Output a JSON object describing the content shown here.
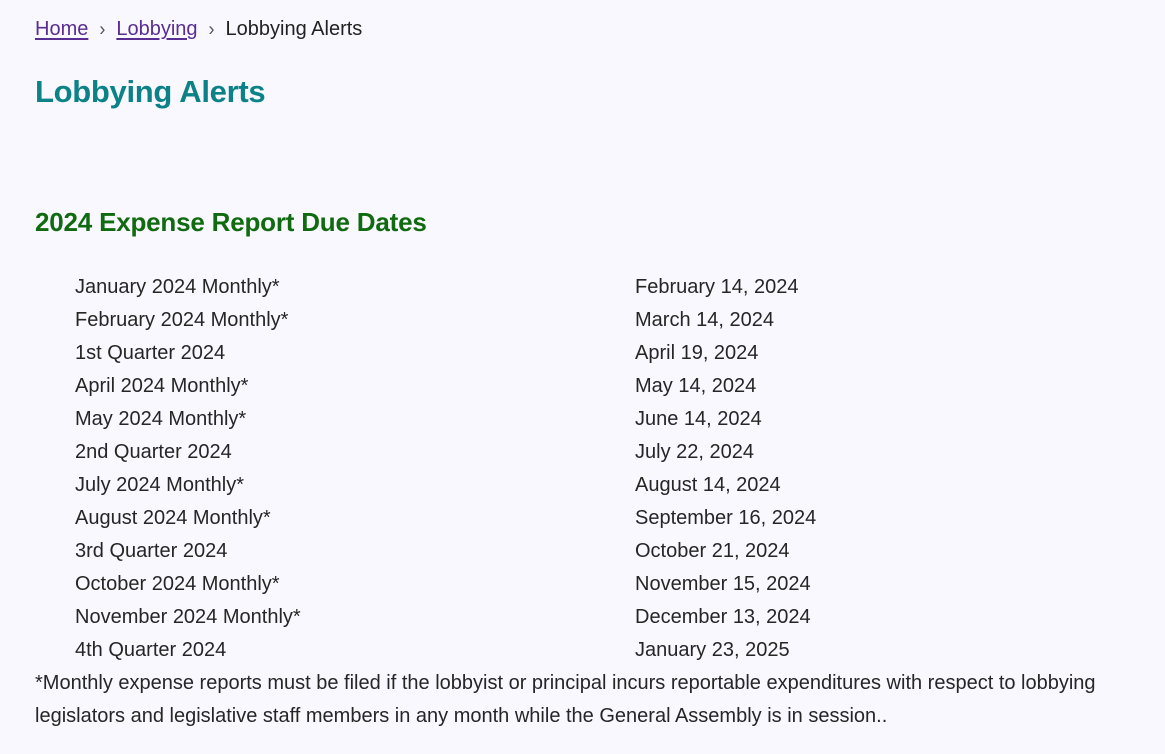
{
  "breadcrumb": {
    "items": [
      {
        "label": "Home",
        "link": true
      },
      {
        "label": "Lobbying",
        "link": true
      },
      {
        "label": "Lobbying Alerts",
        "link": false
      }
    ],
    "separator": "›"
  },
  "page_title": "Lobbying Alerts",
  "section": {
    "title": "2024 Expense Report Due Dates",
    "rows": [
      {
        "period": "January 2024 Monthly*",
        "due": "February 14, 2024"
      },
      {
        "period": "February 2024 Monthly*",
        "due": "March 14, 2024"
      },
      {
        "period": "1st Quarter 2024",
        "due": "April 19, 2024"
      },
      {
        "period": "April 2024 Monthly*",
        "due": "May 14, 2024"
      },
      {
        "period": "May 2024 Monthly*",
        "due": "June 14, 2024"
      },
      {
        "period": "2nd Quarter 2024",
        "due": "July 22, 2024"
      },
      {
        "period": "July 2024 Monthly*",
        "due": "August 14, 2024"
      },
      {
        "period": "August 2024 Monthly*",
        "due": "September 16, 2024"
      },
      {
        "period": "3rd Quarter 2024",
        "due": "October 21, 2024"
      },
      {
        "period": "October 2024 Monthly*",
        "due": "November 15, 2024"
      },
      {
        "period": "November 2024 Monthly*",
        "due": "December 13, 2024"
      },
      {
        "period": "4th Quarter 2024",
        "due": "January 23, 2025"
      }
    ],
    "footnote": "*Monthly expense reports must be filed if the lobbyist or principal incurs reportable expenditures with respect to lobbying legislators and legislative staff members in any month while the General Assembly is in session.."
  },
  "colors": {
    "background": "#f8f8fe",
    "link": "#5a2d91",
    "page_title": "#0b8288",
    "section_title": "#106b10",
    "text": "#262626"
  }
}
